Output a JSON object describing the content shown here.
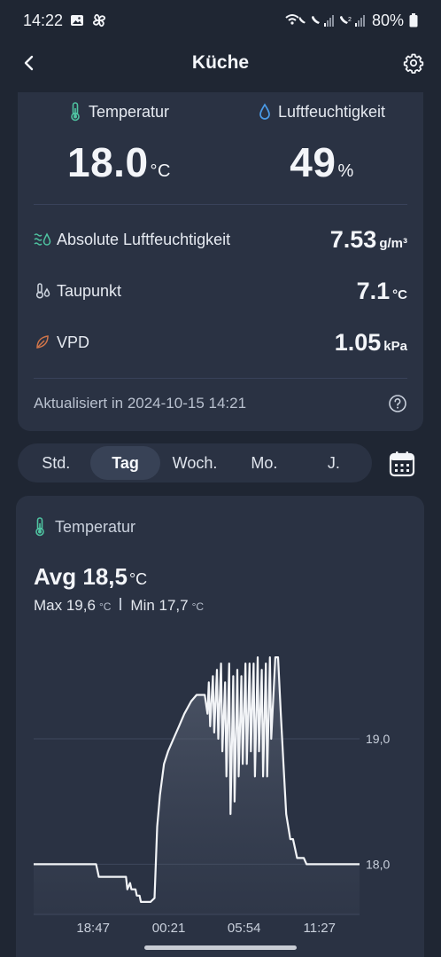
{
  "status_bar": {
    "time": "14:22",
    "battery": "80%",
    "left_icons": [
      "image-icon",
      "fan-icon"
    ],
    "right_icons": [
      "wifi-call-icon",
      "call-signal-icon",
      "call-signal-icon-2",
      "battery-icon"
    ]
  },
  "header": {
    "title": "Küche"
  },
  "current": {
    "temperature": {
      "label": "Temperatur",
      "value": "18.0",
      "unit": "°C"
    },
    "humidity": {
      "label": "Luftfeuchtigkeit",
      "value": "49",
      "unit": "%"
    },
    "absolute_humidity": {
      "label": "Absolute Luftfeuchtigkeit",
      "value": "7.53",
      "unit": "g/m³"
    },
    "dew_point": {
      "label": "Taupunkt",
      "value": "7.1",
      "unit": "°C"
    },
    "vpd": {
      "label": "VPD",
      "value": "1.05",
      "unit": "kPa"
    },
    "updated": "Aktualisiert in 2024-10-15 14:21"
  },
  "tabs": [
    {
      "label": "Std.",
      "active": false
    },
    {
      "label": "Tag",
      "active": true
    },
    {
      "label": "Woch.",
      "active": false
    },
    {
      "label": "Mo.",
      "active": false
    },
    {
      "label": "J.",
      "active": false
    }
  ],
  "chart_panel": {
    "title": "Temperatur",
    "avg_label": "Avg 18,5",
    "avg_unit": "°C",
    "max_label": "Max 19,6",
    "min_label": "Min 17,7",
    "unit": "°C"
  },
  "colors": {
    "background": "#1f2633",
    "card": "#2a3243",
    "line": "#f2f4f7",
    "thermometer_accent": "#4fc3a1",
    "droplet_accent": "#4a9be8",
    "leaf_accent": "#d0754a"
  },
  "chart_data": {
    "type": "area",
    "title": "",
    "xlabel": "",
    "ylabel": "",
    "ylim": [
      17.6,
      19.7
    ],
    "x_tick_labels": [
      "18:47",
      "00:21",
      "05:54",
      "11:27"
    ],
    "y_tick_labels": [
      "19,0",
      "18,0"
    ],
    "y_tick_values": [
      19.0,
      18.0
    ],
    "grid": true,
    "x_range_hours": [
      14.4,
      38.4
    ],
    "x_ticks_hours": [
      18.78,
      24.35,
      29.9,
      35.45
    ],
    "series": [
      {
        "x_hours": [
          14.4,
          19.0,
          19.1,
          19.2,
          19.3,
          21.2,
          21.3,
          21.5,
          21.6,
          21.9,
          22.0,
          22.2,
          22.3,
          23.0,
          23.3,
          23.5,
          23.7,
          24.0,
          24.3,
          24.7,
          25.1,
          25.5,
          26.0,
          26.4,
          26.8,
          27.0,
          27.2,
          27.3,
          27.4,
          27.6,
          27.7,
          27.9,
          28.0,
          28.2,
          28.3,
          28.5,
          28.6,
          28.8,
          28.9,
          29.1,
          29.2,
          29.4,
          29.5,
          29.7,
          29.8,
          30.0,
          30.1,
          30.3,
          30.4,
          30.6,
          30.7,
          30.9,
          31.0,
          31.2,
          31.3,
          31.5,
          31.6,
          31.8,
          31.9,
          32.2,
          32.4,
          32.6,
          32.8,
          33.0,
          33.3,
          33.5,
          33.8,
          34.0,
          34.3,
          34.5,
          34.8,
          35.0,
          35.2,
          35.5,
          35.8,
          36.0,
          36.2,
          36.6,
          37.0,
          38.0,
          38.4
        ],
        "values": [
          18.0,
          18.0,
          17.95,
          17.9,
          17.9,
          17.9,
          17.8,
          17.85,
          17.8,
          17.8,
          17.75,
          17.75,
          17.7,
          17.7,
          17.73,
          18.3,
          18.55,
          18.8,
          18.9,
          19.0,
          19.1,
          19.2,
          19.3,
          19.35,
          19.35,
          19.35,
          19.2,
          19.45,
          19.1,
          19.5,
          19.05,
          19.55,
          19.0,
          19.6,
          18.9,
          19.45,
          18.7,
          19.6,
          18.4,
          19.5,
          18.5,
          19.55,
          18.7,
          19.5,
          18.8,
          19.6,
          18.8,
          19.6,
          18.9,
          19.6,
          18.7,
          19.65,
          18.9,
          19.55,
          18.7,
          19.6,
          18.7,
          19.65,
          19.0,
          19.65,
          19.65,
          19.2,
          18.8,
          18.4,
          18.2,
          18.2,
          18.05,
          18.05,
          18.05,
          18.0,
          18.0,
          18.0,
          18.0,
          18.0,
          18.0,
          18.0,
          18.0,
          18.0,
          18.0,
          18.0,
          18.0
        ]
      }
    ]
  }
}
